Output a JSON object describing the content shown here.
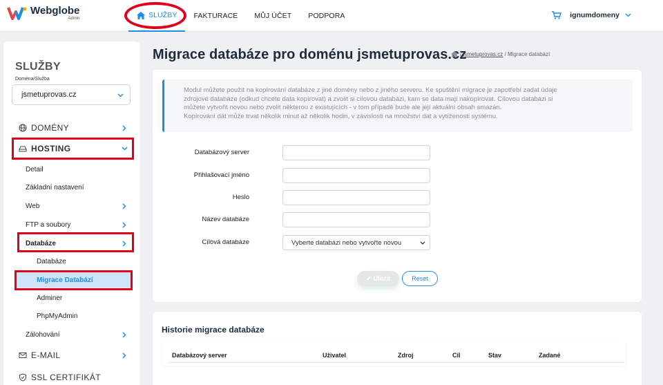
{
  "brand": {
    "name": "Webglobe",
    "sub": "Admin"
  },
  "nav": {
    "items": [
      "SLUŽBY",
      "FAKTURACE",
      "MŮJ ÚČET",
      "PODPORA"
    ]
  },
  "user": {
    "name": "ignumdomeny"
  },
  "sidebar": {
    "title": "SLUŽBY",
    "domain_label": "Doména/Služba",
    "domain_value": "jsmetuprovas.cz",
    "domeny": "DOMÉNY",
    "hosting": "HOSTING",
    "hosting_items": [
      "Detail",
      "Základní nastavení",
      "Web",
      "FTP a soubory",
      "Databáze"
    ],
    "db_items": [
      "Databáze",
      "Migrace Databází",
      "Adminer",
      "PhpMyAdmin"
    ],
    "zalohovani": "Zálohování",
    "email": "E-MAIL",
    "ssl": "SSL CERTIFIKÁT"
  },
  "main": {
    "title": "Migrace databáze pro doménu jsmetuprovas.cz",
    "breadcrumb": {
      "sep1": "/",
      "link": "jsmetuprovas.cz",
      "sep2": "/",
      "current": "Migrace databází"
    },
    "info_lines": [
      "Modul můžete použít na kopírování databáze z jiné domény nebo z jiného serveru. Ke spuštění migrace je zapotřebí zadat údaje",
      "zdrojové databáze (odkud chcete data kopírovat) a zvolit si cílovou databázi, kam se data mají nakopírovat. Cílovou databázi si",
      "můžete vytvořit novou nebo zvolit některou z existujících - v tom případě bude ale její aktuální obsah smazán.",
      "Kopírování dát může trvat několik minut až několik hodin, v závislosti na množství dat a vytíženosti systému."
    ],
    "form": {
      "server_label": "Databázový server",
      "login_label": "Přihlašovací jméno",
      "password_label": "Heslo",
      "dbname_label": "Název databáze",
      "target_label": "Cílová databáze",
      "target_value": "Vyberte databázi nebo vytvořte novou"
    },
    "save_label": "Uložit",
    "reset_label": "Reset",
    "history": {
      "title": "Historie migrace databáze",
      "columns": [
        "Databázový server",
        "Uživatel",
        "Zdroj",
        "Cíl",
        "Stav",
        "Zadané"
      ]
    }
  },
  "colors": {
    "accent": "#1a8fe3",
    "annotation": "#e1001a"
  }
}
